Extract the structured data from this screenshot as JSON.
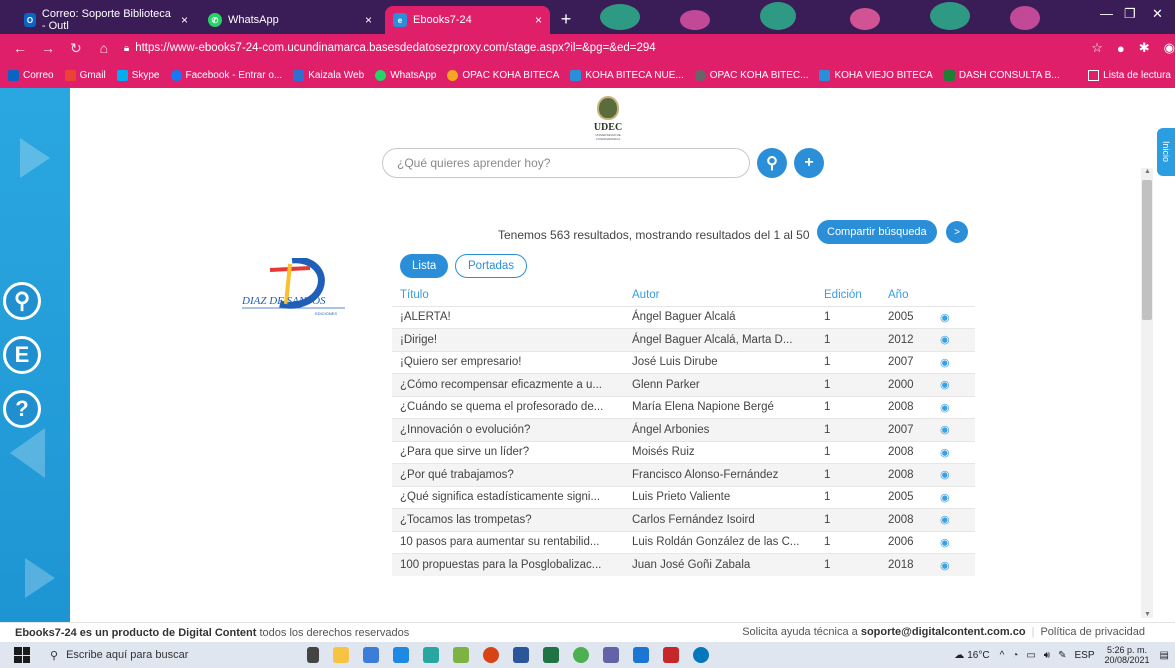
{
  "browser": {
    "tabs": [
      {
        "label": "Correo: Soporte Biblioteca - Outl",
        "close": "×",
        "color": "#0a64c4",
        "icon": "outlook-icon"
      },
      {
        "label": "WhatsApp",
        "close": "×",
        "color": "#25d366",
        "icon": "whatsapp-icon"
      },
      {
        "label": "Ebooks7-24",
        "close": "×",
        "color": "#2a8fd8",
        "icon": "ebooks-icon"
      }
    ],
    "new_tab": "+",
    "url": "https://www-ebooks7-24-com.ucundinamarca.basesdedatosezproxy.com/stage.aspx?il=&pg=&ed=294",
    "bookmarks": [
      {
        "label": "Correo",
        "color": "#0a64c4"
      },
      {
        "label": "Gmail",
        "color": "#ea4335"
      },
      {
        "label": "Skype",
        "color": "#00aff0"
      },
      {
        "label": "Facebook - Entrar o...",
        "color": "#1877f2"
      },
      {
        "label": "Kaizala Web",
        "color": "#2f6fd1"
      },
      {
        "label": "WhatsApp",
        "color": "#25d366"
      },
      {
        "label": "OPAC KOHA BITECA",
        "color": "#f5a623"
      },
      {
        "label": "KOHA BITECA NUE...",
        "color": "#2a8fd8"
      },
      {
        "label": "OPAC KOHA BITEC...",
        "color": "#666666"
      },
      {
        "label": "KOHA VIEJO BITECA",
        "color": "#2a8fd8"
      },
      {
        "label": "DASH CONSULTA B...",
        "color": "#1e7e34"
      }
    ],
    "reading_list": "Lista de lectura"
  },
  "header": {
    "logo_name": "UDEC",
    "logo_subtitle": "UNIVERSIDAD DE CUNDINAMARCA"
  },
  "search": {
    "placeholder": "¿Qué quieres aprender hoy?",
    "search_glyph": "⚲",
    "add_glyph": "+"
  },
  "results": {
    "summary": "Tenemos 563 resultados, mostrando resultados del 1 al 50",
    "share_label": "Compartir búsqueda",
    "next_glyph": ">"
  },
  "publisher_logo": {
    "name": "DIAZ DE SANTOS",
    "sub": "EDICIONES"
  },
  "view": {
    "list_label": "Lista",
    "covers_label": "Portadas"
  },
  "table": {
    "headers": {
      "title": "Título",
      "author": "Autor",
      "edition": "Edición",
      "year": "Año"
    },
    "rows": [
      {
        "title": "¡ALERTA!",
        "author": "Ángel Baguer Alcalá",
        "edition": "1",
        "year": "2005"
      },
      {
        "title": "¡Dirige!",
        "author": "Ángel Baguer Alcalá, Marta D...",
        "edition": "1",
        "year": "2012"
      },
      {
        "title": "¡Quiero ser empresario!",
        "author": "José Luis Dirube",
        "edition": "1",
        "year": "2007"
      },
      {
        "title": "¿Cómo recompensar eficazmente a u...",
        "author": "Glenn Parker",
        "edition": "1",
        "year": "2000"
      },
      {
        "title": "¿Cuándo se quema el profesorado de...",
        "author": "María Elena Napione Bergé",
        "edition": "1",
        "year": "2008"
      },
      {
        "title": "¿Innovación o evolución?",
        "author": "Ángel Arbonies",
        "edition": "1",
        "year": "2007"
      },
      {
        "title": "¿Para que sirve un líder?",
        "author": "Moisés Ruiz",
        "edition": "1",
        "year": "2008"
      },
      {
        "title": "¿Por qué trabajamos?",
        "author": "Francisco Alonso-Fernández",
        "edition": "1",
        "year": "2008"
      },
      {
        "title": "¿Qué significa estadísticamente signi...",
        "author": "Luis Prieto Valiente",
        "edition": "1",
        "year": "2005"
      },
      {
        "title": "¿Tocamos las trompetas?",
        "author": "Carlos Fernández Isoird",
        "edition": "1",
        "year": "2008"
      },
      {
        "title": "10 pasos para aumentar su rentabilid...",
        "author": "Luis Roldán González de las C...",
        "edition": "1",
        "year": "2006"
      },
      {
        "title": "100 propuestas para la Posglobalizac...",
        "author": "Juan José Goñi Zabala",
        "edition": "1",
        "year": "2018"
      }
    ]
  },
  "sidebar": {
    "search_glyph": "⚲",
    "e_glyph": "E",
    "help_glyph": "?",
    "right_tab": "Inicio"
  },
  "footer": {
    "brand": "Ebooks7-24 es un producto de Digital Content",
    "rights": " todos los derechos reservados",
    "support_prefix": "Solicita ayuda técnica a ",
    "support_email": "soporte@digitalcontent.com.co",
    "privacy": "Política de privacidad"
  },
  "taskbar": {
    "search_placeholder": "Escribe aquí para buscar",
    "weather": "16°C",
    "lang": "ESP",
    "time": "5:26 p. m.",
    "date": "20/08/2021"
  }
}
